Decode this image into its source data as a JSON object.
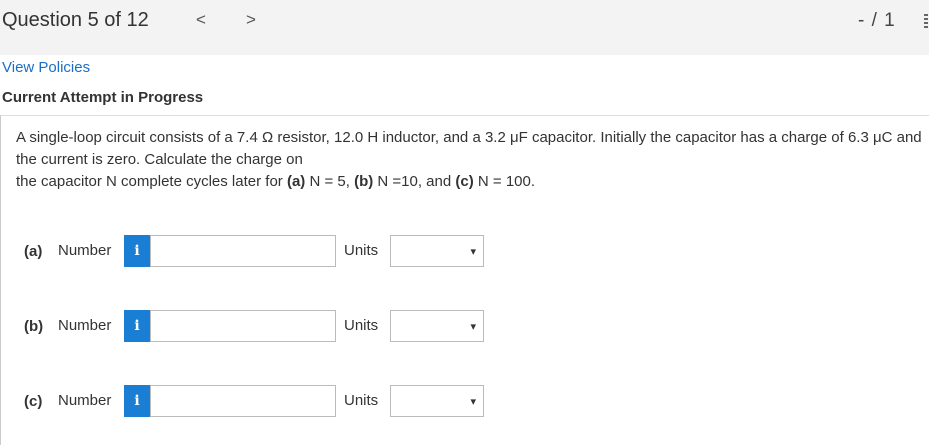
{
  "header": {
    "question_title": "Question 5 of 12",
    "prev_icon": "chevron-left-icon",
    "next_icon": "chevron-right-icon",
    "prev_glyph": "<",
    "next_glyph": ">",
    "score": "- / 1",
    "menu_icon": "more-vertical-icon"
  },
  "links": {
    "view_policies": "View Policies"
  },
  "attempt_label": "Current Attempt in Progress",
  "question": {
    "line1": "A single-loop circuit consists of a 7.4 Ω resistor, 12.0 H inductor, and a 3.2 μF capacitor. Initially the capacitor has a charge of 6.3 μC and the current is zero. Calculate the charge on",
    "line2_pre": "the capacitor N complete cycles later for ",
    "a_tag": "(a)",
    "a_expr": " N = 5, ",
    "b_tag": "(b)",
    "b_expr": " N =10, and ",
    "c_tag": "(c)",
    "c_expr": " N = 100."
  },
  "parts": [
    {
      "label": "(a)",
      "number_label": "Number",
      "info_glyph": "i",
      "value": "",
      "units_label": "Units",
      "units_selected": ""
    },
    {
      "label": "(b)",
      "number_label": "Number",
      "info_glyph": "i",
      "value": "",
      "units_label": "Units",
      "units_selected": ""
    },
    {
      "label": "(c)",
      "number_label": "Number",
      "info_glyph": "i",
      "value": "",
      "units_label": "Units",
      "units_selected": ""
    }
  ],
  "colors": {
    "accent": "#1a7fd4",
    "link": "#1a6fc4",
    "topbar_bg": "#f3f3f3"
  }
}
